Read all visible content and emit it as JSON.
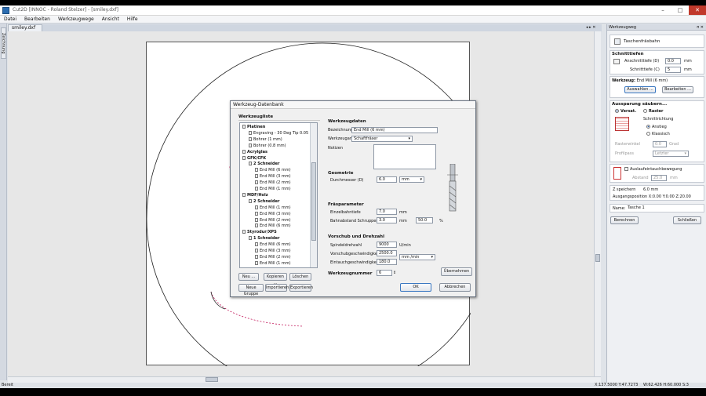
{
  "window": {
    "title": "Cut2D [INNOC - Roland Stelzer] - [smiley.dxf]",
    "controls": [
      "–",
      "□",
      "✕"
    ]
  },
  "menu": [
    "Datei",
    "Bearbeiten",
    "Werkzeugwege",
    "Ansicht",
    "Hilfe"
  ],
  "left_tab": "Zeichnung",
  "doc_tab": "smiley.dxf",
  "canvas_controls": {
    "nav": "◂ ▸ ✕"
  },
  "panel": {
    "header": "Werkzeugweg",
    "pin": "ᴨ ✕",
    "section_title": "Taschenfräsbahn",
    "schnitttiefen": {
      "title": "Schnitttiefen",
      "anschnitt_label": "Anschnitttiefe (D)",
      "anschnitt_value": "0.0",
      "schnitt_label": "Schnitttiefe (C)",
      "schnitt_value": "5",
      "unit": "mm"
    },
    "werkzeug": {
      "title": "Werkzeug:",
      "name": "End Mill (6 mm)",
      "select_btn": "Auswahlen ...",
      "edit_btn": "Bearbeiten ..."
    },
    "aussparung": {
      "title": "Aussparung säubern...",
      "opt1": "Versat.",
      "opt2": "Raster",
      "schnittrichtung": "Schnittrichtung",
      "anstieg": "Anstieg",
      "klassisch": "Klassisch",
      "rasterwinkel_label": "Rasterwinkel",
      "rasterwinkel_value": "0.0",
      "grad": "Grad",
      "profil_label": "Profilpass",
      "profil_value": "Letzter"
    },
    "auslauf": {
      "label": "Auslaufeintauchbewegung",
      "abstand_label": "Abstand",
      "abstand_value": "25.0",
      "unit": "mm"
    },
    "info": {
      "z_label": "Z speichern",
      "z_value": "6.0 mm",
      "origin": "Ausgangsposition X:0.00 Y:0.00 Z:20.00"
    },
    "name_label": "Name:",
    "name_value": "Tasche 1",
    "calc_btn": "Berechnen",
    "close_btn": "Schließen"
  },
  "dialog": {
    "title": "Werkzeug-Datenbank",
    "tree_title": "Werkzeugliste",
    "tree": [
      {
        "text": "Platinen",
        "lvl": 0,
        "bold": true
      },
      {
        "text": "Engraving - 30 Deg Tip 0.05 - 1",
        "lvl": 1
      },
      {
        "text": "Bohrer (1 mm)",
        "lvl": 1
      },
      {
        "text": "Bohrer (0.8 mm)",
        "lvl": 1
      },
      {
        "text": "Acrylglas",
        "lvl": 0,
        "bold": true
      },
      {
        "text": "GFK/CFK",
        "lvl": 0,
        "bold": true
      },
      {
        "text": "2 Schneider",
        "lvl": 1,
        "bold": true
      },
      {
        "text": "End Mill (6 mm)",
        "lvl": 2
      },
      {
        "text": "End Mill (3 mm)",
        "lvl": 2
      },
      {
        "text": "End Mill (2 mm)",
        "lvl": 2
      },
      {
        "text": "End Mill (1 mm)",
        "lvl": 2
      },
      {
        "text": "MDF/Holz",
        "lvl": 0,
        "bold": true
      },
      {
        "text": "2 Schneider",
        "lvl": 1,
        "bold": true
      },
      {
        "text": "End Mill (1 mm)",
        "lvl": 2
      },
      {
        "text": "End Mill (3 mm)",
        "lvl": 2
      },
      {
        "text": "End Mill (2 mm)",
        "lvl": 2
      },
      {
        "text": "End Mill (6 mm)",
        "lvl": 2
      },
      {
        "text": "Styrodur/XPS",
        "lvl": 0,
        "bold": true
      },
      {
        "text": "1 Schneider",
        "lvl": 1,
        "bold": true
      },
      {
        "text": "End Mill (6 mm)",
        "lvl": 2
      },
      {
        "text": "End Mill (3 mm)",
        "lvl": 2
      },
      {
        "text": "End Mill (2 mm)",
        "lvl": 2
      },
      {
        "text": "End Mill (1 mm)",
        "lvl": 2
      }
    ],
    "btn_new": "Neu ...",
    "btn_copy": "Kopieren ...",
    "btn_delete": "Löschen",
    "btn_group": "Neue Gruppe",
    "btn_import": "Importieren",
    "btn_export": "Exportieren",
    "werkzeugdaten": "Werkzeugdaten",
    "bezeichnung_label": "Bezeichnung",
    "bezeichnung_value": "End Mill (6 mm)",
    "werkzeugart_label": "Werkzeugart",
    "werkzeugart_value": "Schaftfräser",
    "notizen_label": "Notizen",
    "geometrie": "Geometrie",
    "durchmesser_label": "Durchmesser (D)",
    "durchmesser_value": "6.0",
    "unit_mm": "mm",
    "fraesparameter": "Fräsparameter",
    "einzel_label": "Einzelbahntiefe",
    "einzel_value": "7.0",
    "bahn_label": "Bahnabstand Schruppen",
    "bahn_value": "3.0",
    "bahn_pct": "50.0",
    "pct": "%",
    "vorschub": "Vorschub und Drehzahl",
    "spindel_label": "Spindeldrehzahl",
    "spindel_value": "9000",
    "spindel_unit": "U/min",
    "vorschubg_label": "Vorschubgeschwindigkeit",
    "vorschubg_value": "2500.0",
    "vorschub_unit": "mm /min",
    "eintauch_label": "Eintauchgeschwindigkeit",
    "eintauch_value": "180.0",
    "werkzeugnummer_label": "Werkzeugnummer",
    "werkzeugnummer_value": "6",
    "btn_uebernehmen": "Übernehmen",
    "btn_ok": "OK",
    "btn_cancel": "Abbrechen"
  },
  "status": {
    "left": "Bereit",
    "coords": "X:137.5000 Y:47.7273",
    "size": "W:62.426  H:60.000  S:3"
  }
}
